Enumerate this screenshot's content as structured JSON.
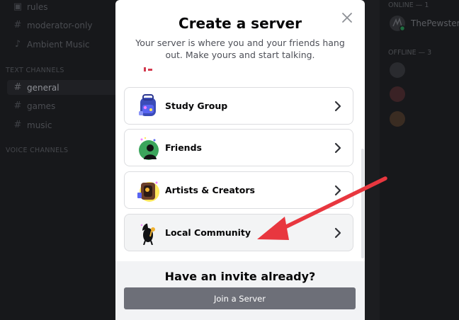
{
  "background": {
    "channels": [
      {
        "icon": "rules-icon",
        "name": "rules"
      },
      {
        "icon": "hash-icon",
        "name": "moderator-only"
      },
      {
        "icon": "speaker-icon",
        "name": "Ambient Music"
      }
    ],
    "text_category": "TEXT CHANNELS",
    "text_channels": [
      {
        "name": "general",
        "active": true
      },
      {
        "name": "games",
        "active": false
      },
      {
        "name": "music",
        "active": false
      }
    ],
    "voice_category": "VOICE CHANNELS",
    "members": {
      "online_header": "ONLINE — 1",
      "online": [
        {
          "name": "ThePewster"
        }
      ],
      "offline_header": "OFFLINE — 3"
    }
  },
  "modal": {
    "title": "Create a server",
    "subtitle": "Your server is where you and your friends hang out. Make yours and start talking.",
    "close_icon": "close-icon",
    "templates": [
      {
        "label": "Study Group",
        "icon": "backpack-icon"
      },
      {
        "label": "Friends",
        "icon": "friends-icon"
      },
      {
        "label": "Artists & Creators",
        "icon": "artists-icon"
      },
      {
        "label": "Local Community",
        "icon": "community-icon"
      }
    ],
    "footer_title": "Have an invite already?",
    "join_button": "Join a Server"
  },
  "colors": {
    "annotation_arrow": "#e8373f",
    "join_button": "#6d6f78",
    "footer_bg": "#f2f3f5"
  }
}
